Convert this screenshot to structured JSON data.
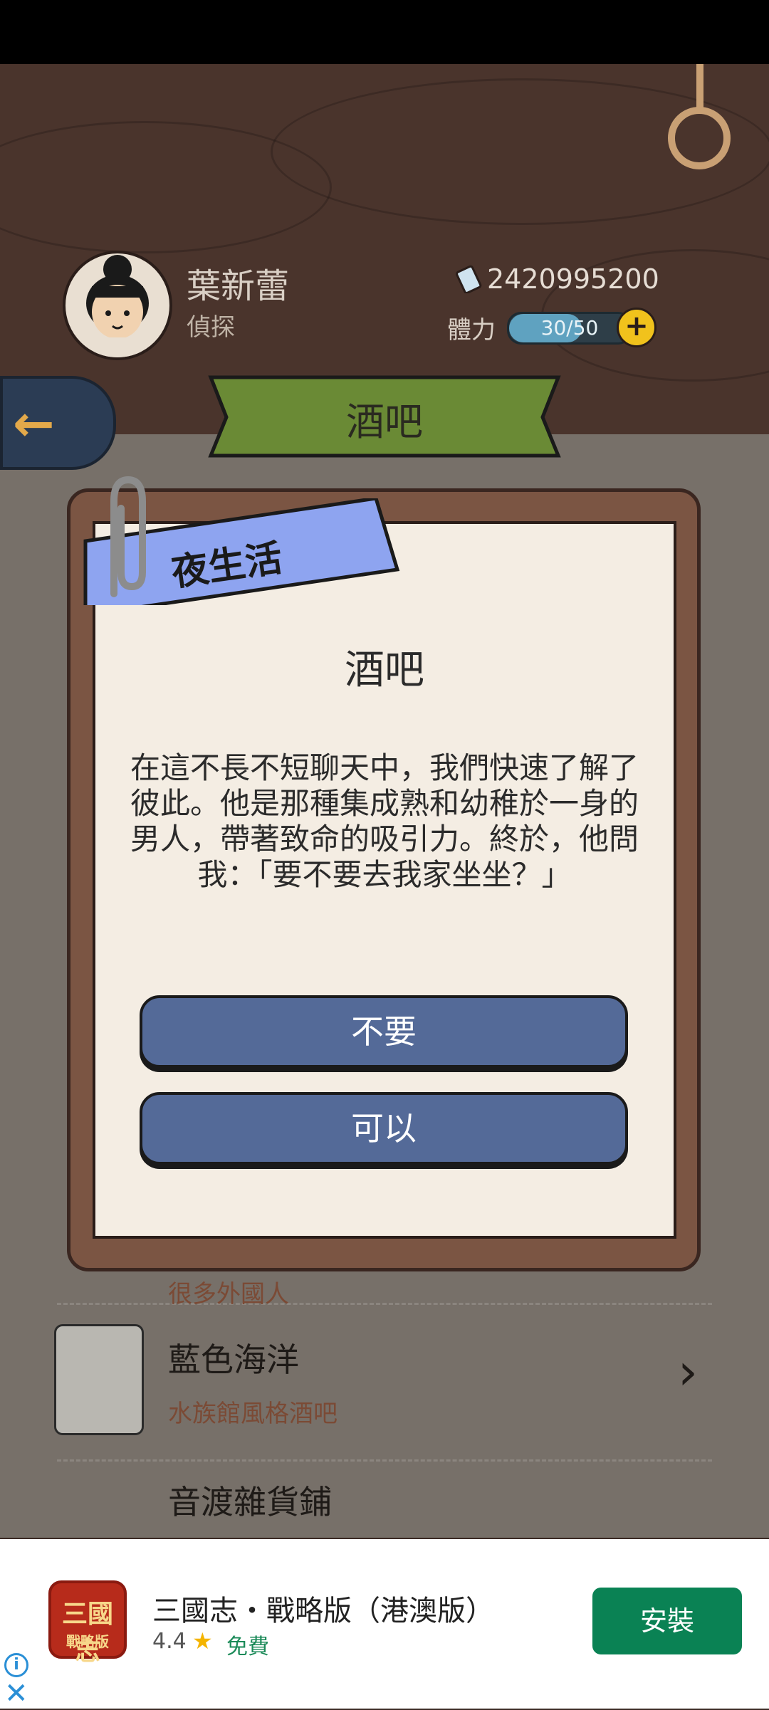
{
  "header": {
    "player_name": "葉新蕾",
    "player_title": "偵探",
    "money": "2420995200",
    "stamina_label": "體力",
    "stamina_text": "30/50",
    "stamina_fraction": 0.6
  },
  "screen_title": "酒吧",
  "background_list": [
    {
      "title": "",
      "subtitle": "很多外國人"
    },
    {
      "title": "藍色海洋",
      "subtitle": "水族館風格酒吧"
    },
    {
      "title": "音渡雜貨鋪",
      "subtitle": ""
    }
  ],
  "dialog": {
    "tag": "夜生活",
    "title": "酒吧",
    "body": "在這不長不短聊天中，我們快速了解了彼此。他是那種集成熟和幼稚於一身的男人，帶著致命的吸引力。終於，他問我：「要不要去我家坐坐？」",
    "option_no": "不要",
    "option_yes": "可以"
  },
  "ad": {
    "title": "三國志・戰略版（港澳版）",
    "rating": "4.4",
    "price": "免費",
    "install": "安裝",
    "icon_text_top": "三國志",
    "icon_text_bottom": "戰略版"
  },
  "colors": {
    "accent_button": "#546a98",
    "banner_green": "#6a8a35",
    "tag_blue": "#8ea4f0",
    "install_green": "#0a8254"
  }
}
